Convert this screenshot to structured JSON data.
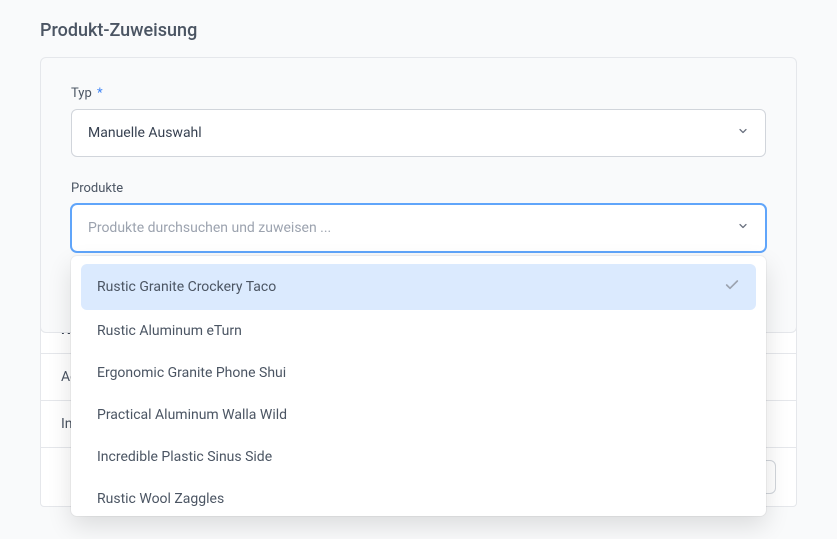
{
  "page": {
    "title": "Produkt-Zuweisung"
  },
  "form": {
    "type": {
      "label": "Typ",
      "required_mark": "*",
      "value": "Manuelle Auswahl"
    },
    "products": {
      "label": "Produkte",
      "placeholder": "Produkte durchsuchen und zuweisen ...",
      "options": [
        {
          "label": "Rustic Granite Crockery Taco",
          "selected": true
        },
        {
          "label": "Rustic Aluminum eTurn",
          "selected": false
        },
        {
          "label": "Ergonomic Granite Phone Shui",
          "selected": false
        },
        {
          "label": "Practical Aluminum Walla Wild",
          "selected": false
        },
        {
          "label": "Incredible Plastic Sinus Side",
          "selected": false
        },
        {
          "label": "Rustic Wool Zaggles",
          "selected": false
        }
      ]
    }
  },
  "table": {
    "header": "Na",
    "rows": [
      "Ae",
      "In"
    ]
  }
}
